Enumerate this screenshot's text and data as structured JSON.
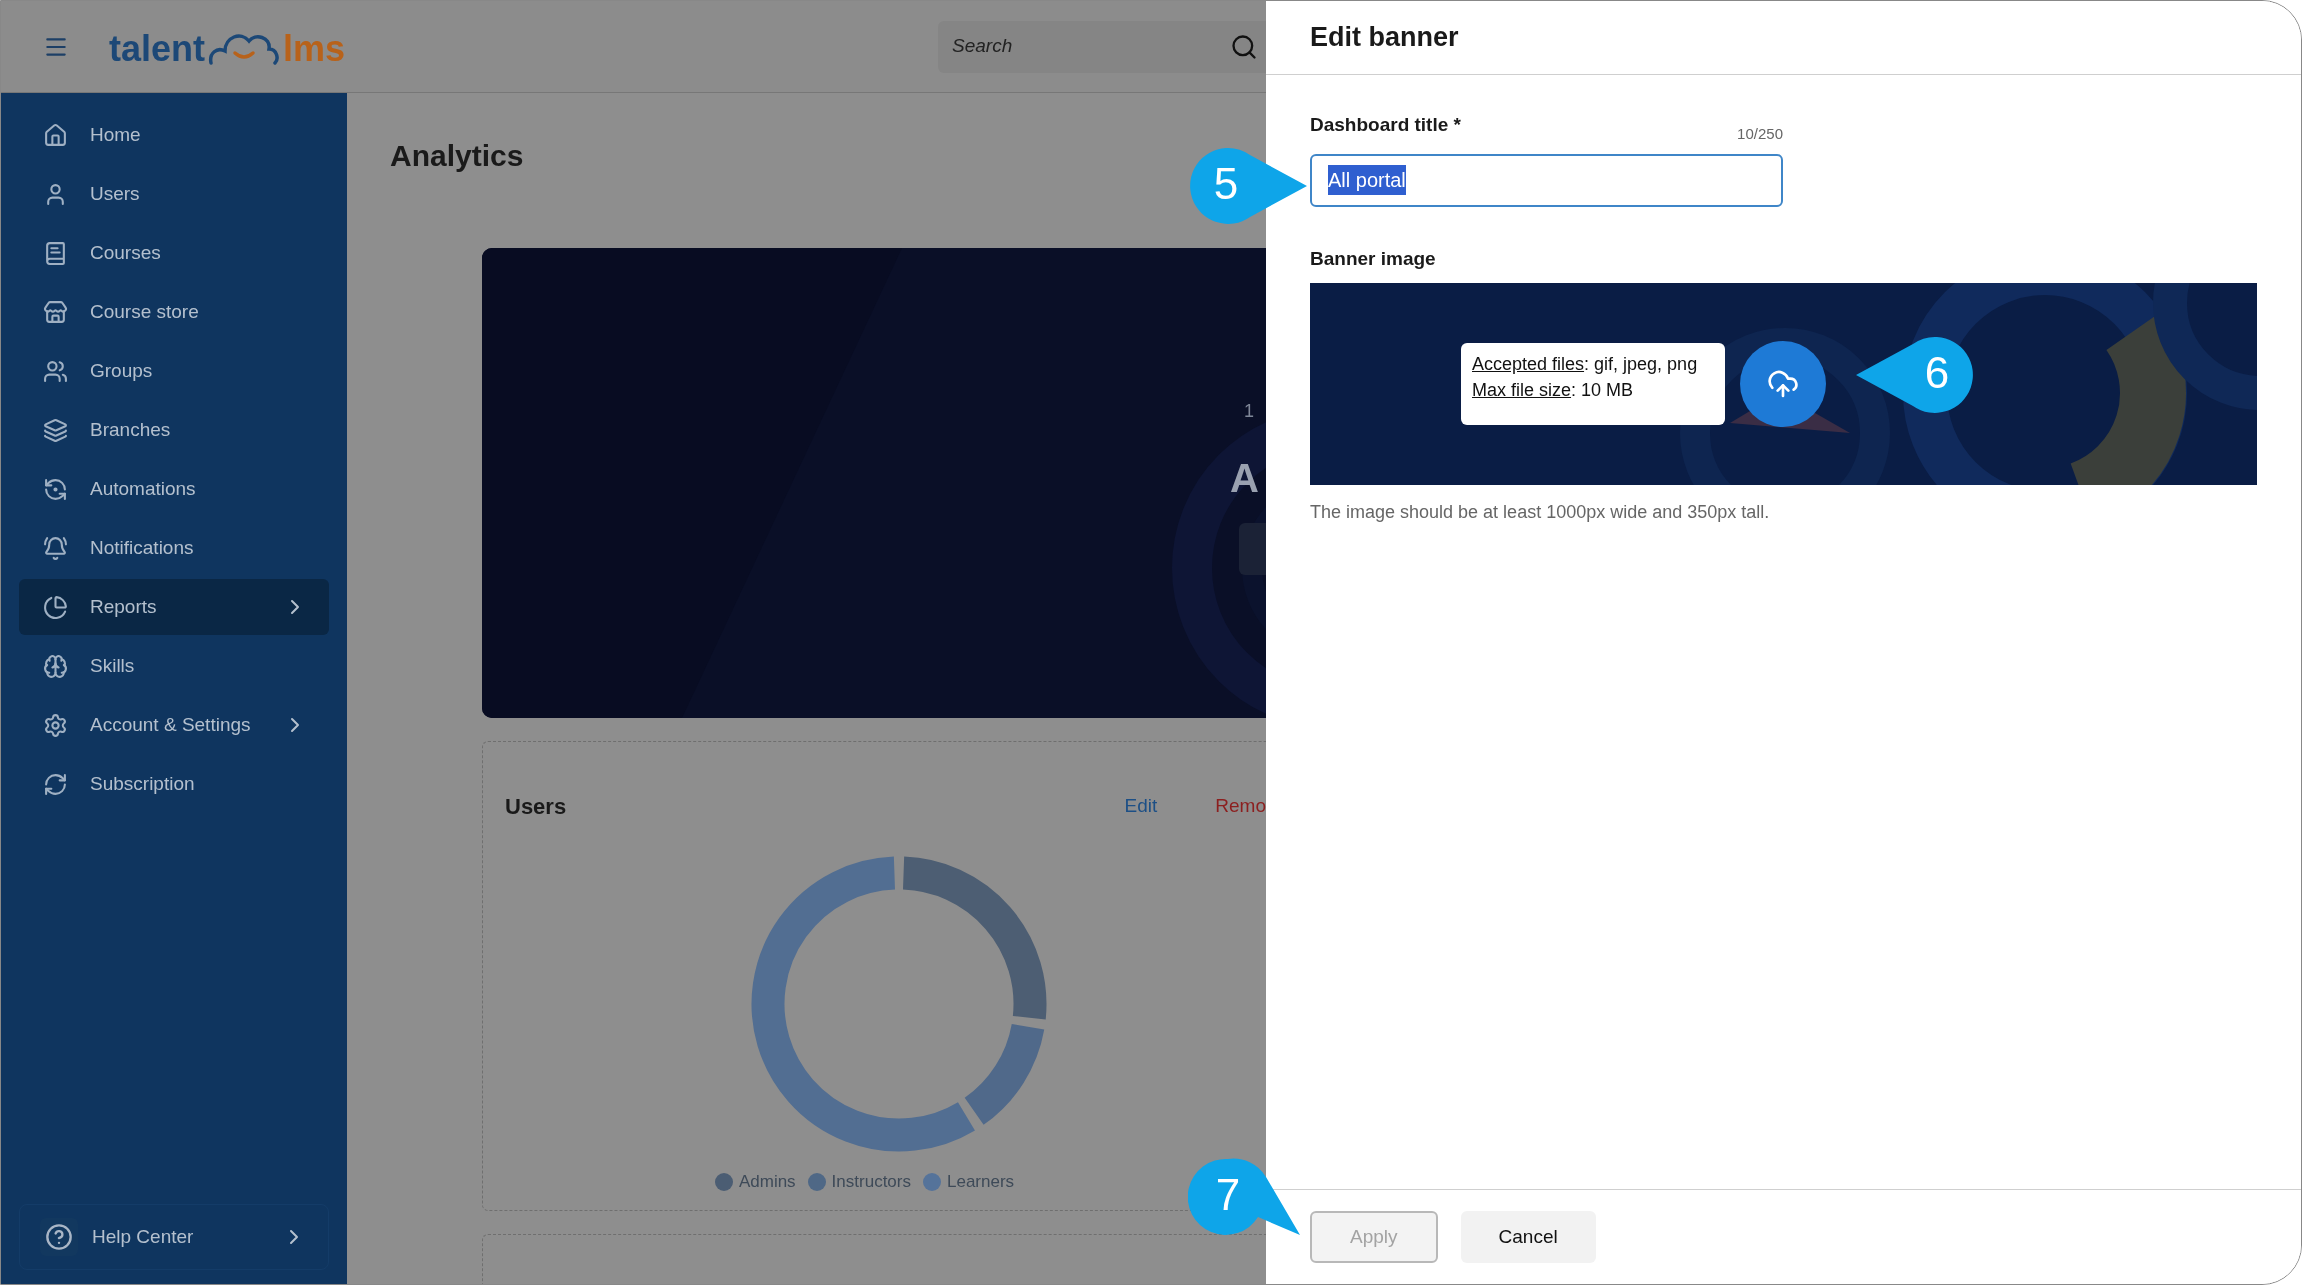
{
  "top_bar": {
    "logo": {
      "part_1": "talent",
      "part_2": "lms"
    },
    "search": {
      "placeholder": "Search"
    }
  },
  "sidebar": {
    "items": [
      {
        "label": "Home",
        "selected": false,
        "has_submenu": false
      },
      {
        "label": "Users",
        "selected": false,
        "has_submenu": false
      },
      {
        "label": "Courses",
        "selected": false,
        "has_submenu": false
      },
      {
        "label": "Course store",
        "selected": false,
        "has_submenu": false
      },
      {
        "label": "Groups",
        "selected": false,
        "has_submenu": false
      },
      {
        "label": "Branches",
        "selected": false,
        "has_submenu": false
      },
      {
        "label": "Automations",
        "selected": false,
        "has_submenu": false
      },
      {
        "label": "Notifications",
        "selected": false,
        "has_submenu": false
      },
      {
        "label": "Reports",
        "selected": true,
        "has_submenu": true
      },
      {
        "label": "Skills",
        "selected": false,
        "has_submenu": false
      },
      {
        "label": "Account & Settings",
        "selected": false,
        "has_submenu": true
      },
      {
        "label": "Subscription",
        "selected": false,
        "has_submenu": false
      }
    ],
    "help": {
      "label": "Help Center"
    }
  },
  "main": {
    "title": "Analytics",
    "banner": {
      "text_1": "1",
      "text_2": "A"
    },
    "users_card": {
      "title": "Users",
      "edit": "Edit",
      "remove": "Remo",
      "legend": [
        {
          "label": "Admins",
          "color": "#4b5d73"
        },
        {
          "label": "Instructors",
          "color": "#4f6886"
        },
        {
          "label": "Learners",
          "color": "#55739a"
        }
      ]
    }
  },
  "drawer": {
    "title": "Edit banner",
    "field": {
      "label": "Dashboard title *",
      "counter": "10/250",
      "value": "All portal",
      "text_selected": true
    },
    "banner_image": {
      "label": "Banner image",
      "tooltip": [
        {
          "link": "Accepted files",
          "text": ": gif, jpeg, png"
        },
        {
          "link": "Max file size",
          "text": ": 10 MB"
        }
      ],
      "hint": "The image should be at least 1000px wide and 350px tall."
    },
    "buttons": [
      {
        "label": "Apply",
        "disabled": true
      },
      {
        "label": "Cancel",
        "disabled": false
      }
    ]
  },
  "callouts": [
    {
      "number": "5"
    },
    {
      "number": "6"
    },
    {
      "number": "7"
    }
  ]
}
